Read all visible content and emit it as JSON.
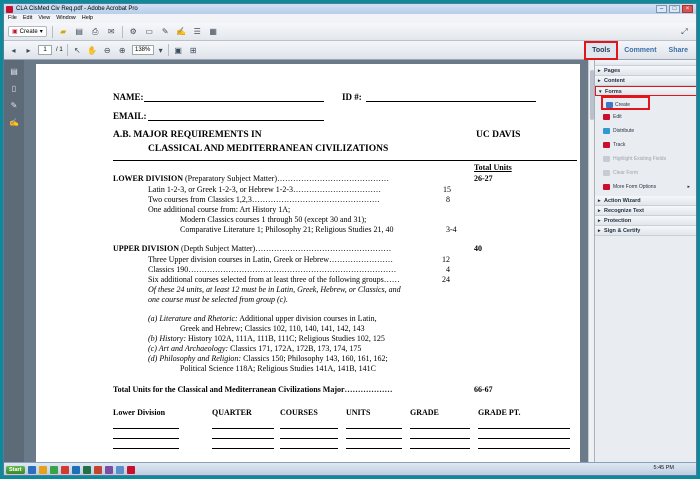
{
  "window": {
    "title": "CLA ClsMed Civ Req.pdf - Adobe Acrobat Pro"
  },
  "menu": [
    "File",
    "Edit",
    "View",
    "Window",
    "Help"
  ],
  "toolbar": {
    "create_label": "Create",
    "page_current": "1",
    "page_total": "/ 1",
    "zoom": "138%"
  },
  "tabs": [
    {
      "label": "Tools"
    },
    {
      "label": "Comment"
    },
    {
      "label": "Share"
    }
  ],
  "panel": {
    "sections_top": [
      "Pages",
      "Content"
    ],
    "forms_label": "Forms",
    "form_items": [
      {
        "label": "Create",
        "enabled": true
      },
      {
        "label": "Edit",
        "enabled": true
      },
      {
        "label": "Distribute",
        "enabled": true
      },
      {
        "label": "Track",
        "enabled": true
      },
      {
        "label": "Highlight Existing Fields",
        "enabled": false
      },
      {
        "label": "Clear Form",
        "enabled": false
      },
      {
        "label": "More Form Options",
        "enabled": true
      }
    ],
    "sections_bottom": [
      "Action Wizard",
      "Recognize Text",
      "Protection",
      "Sign & Certify"
    ]
  },
  "doc": {
    "name_label": "NAME:",
    "id_label": "ID #:",
    "email_label": "EMAIL:",
    "title_line1": "A.B. MAJOR REQUIREMENTS IN",
    "title_line2": "CLASSICAL AND MEDITERRANEAN CIVILIZATIONS",
    "campus": "UC DAVIS",
    "total_units_header": "Total Units",
    "lower_heading_bold": "LOWER DIVISION",
    "lower_heading_rest": "(Preparatory Subject Matter)……………………………………",
    "lower_total": "26-27",
    "lower_lines": [
      {
        "text": "Latin 1-2-3, or Greek 1-2-3, or Hebrew 1-2-3……………………………",
        "units": "15"
      },
      {
        "text": "Two courses from Classics 1,2,3…………………………………………",
        "units": "8"
      },
      {
        "text": "One additional course from:  Art History 1A;",
        "units": ""
      },
      {
        "text": "Modern Classics courses 1 through 50 (except 30 and 31);",
        "units": ""
      },
      {
        "text": "Comparative Literature 1; Philosophy 21; Religious Studies 21, 40",
        "units": "3-4"
      }
    ],
    "upper_heading_bold": "UPPER DIVISION",
    "upper_heading_rest": "(Depth Subject Matter)……………………………………………",
    "upper_total": "40",
    "upper_lines": [
      {
        "text": "Three Upper division courses in Latin, Greek or Hebrew……………………",
        "units": "12"
      },
      {
        "text": "Classics 190……………………………………………………………………",
        "units": "4"
      },
      {
        "text": "Six additional courses selected from at least three of the following groups……",
        "units": "24"
      }
    ],
    "upper_note1": "Of these 24 units, at least 12 must be in Latin, Greek, Hebrew, or Classics, and",
    "upper_note2": "one course must be selected from group (c).",
    "groups": [
      {
        "label": "(a)  Literature and Rhetoric:",
        "text": "Additional upper division courses in Latin,"
      },
      {
        "label": "",
        "text": "Greek and Hebrew; Classics 102, 110, 140, 141, 142, 143"
      },
      {
        "label": "(b)  History:",
        "text": "History 102A, 111A, 111B, 111C; Religious Studies 102, 125"
      },
      {
        "label": "(c)  Art and Archaeology:",
        "text": "Classics 171, 172A, 172B, 173, 174, 175"
      },
      {
        "label": "(d)  Philosophy and Religion:",
        "text": "Classics 150; Philosophy 143, 160, 161, 162;"
      },
      {
        "label": "",
        "text": "Political Science 118A; Religious Studies 141A, 141B, 141C"
      }
    ],
    "total_line": "Total Units for the Classical and Mediterranean Civilizations Major………………",
    "total_value": "66-67",
    "table_headers": [
      "Lower Division",
      "QUARTER",
      "COURSES",
      "UNITS",
      "GRADE",
      "GRADE PT."
    ]
  },
  "taskbar": {
    "start_label": "Start",
    "clock": "5:45 PM"
  }
}
